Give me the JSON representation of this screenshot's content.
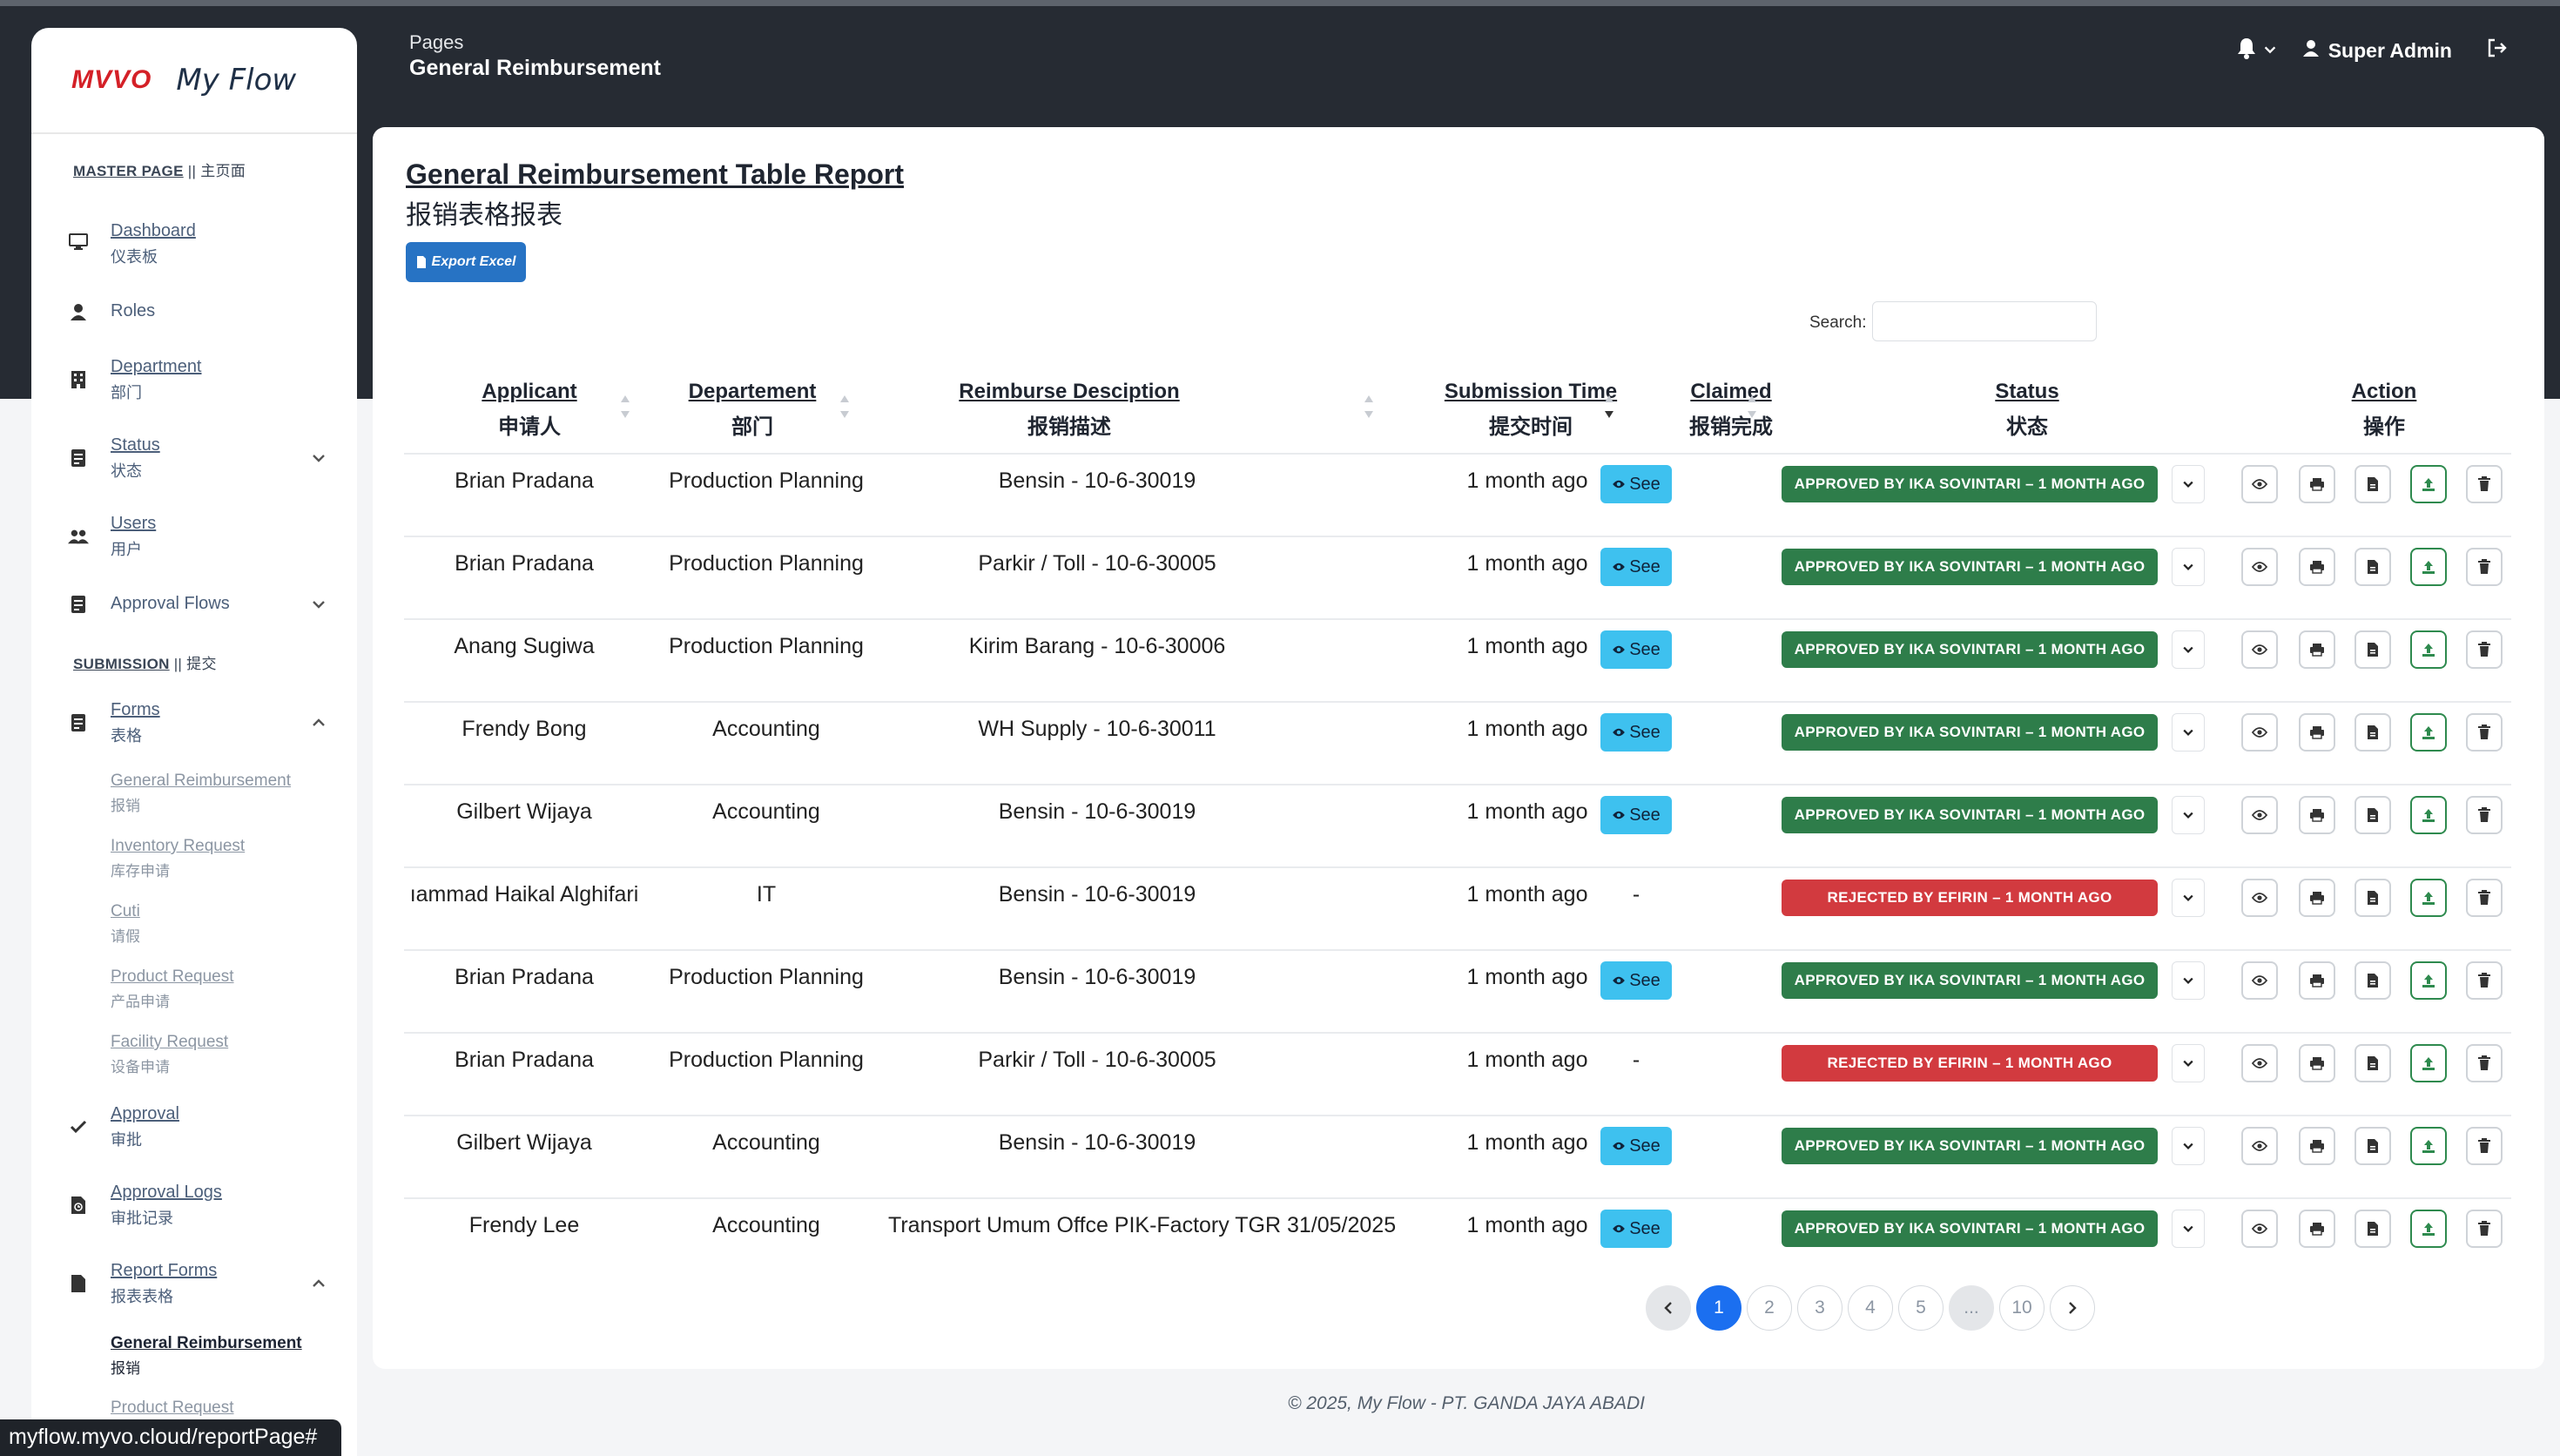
{
  "app": {
    "logo": "MVVO",
    "name": "My Flow"
  },
  "header": {
    "crumb": "Pages",
    "title": "General Reimbursement",
    "user": "Super Admin"
  },
  "sidebar": {
    "master_en": "MASTER PAGE",
    "master_cn": " || 主页面",
    "submission_en": "SUBMISSION",
    "submission_cn": " || 提交",
    "items": [
      {
        "label": "Dashboard",
        "cn": "仪表板"
      },
      {
        "label": "Roles",
        "cn": ""
      },
      {
        "label": "Department",
        "cn": "部门"
      },
      {
        "label": "Status",
        "cn": "状态"
      },
      {
        "label": "Users",
        "cn": "用户"
      },
      {
        "label": "Approval Flows",
        "cn": ""
      },
      {
        "label": "Forms",
        "cn": "表格"
      },
      {
        "label": "Approval",
        "cn": "审批"
      },
      {
        "label": "Approval Logs",
        "cn": "审批记录"
      },
      {
        "label": "Report Forms",
        "cn": "报表表格"
      }
    ],
    "forms_sub": [
      {
        "label": "General Reimbursement",
        "cn": "报销"
      },
      {
        "label": "Inventory Request",
        "cn": "库存申请"
      },
      {
        "label": "Cuti",
        "cn": "请假"
      },
      {
        "label": "Product Request",
        "cn": "产品申请"
      },
      {
        "label": "Facility Request",
        "cn": "设备申请"
      }
    ],
    "report_sub": [
      {
        "label": "General Reimbursement",
        "cn": "报销"
      },
      {
        "label": "Product Request",
        "cn": ""
      }
    ]
  },
  "report": {
    "title": "General Reimbursement Table Report",
    "title_cn": "报销表格报表",
    "export_label": "Export Excel",
    "search_label": "Search:",
    "search_value": ""
  },
  "columns": [
    {
      "en": "Applicant",
      "cn": "申请人"
    },
    {
      "en": "Departement",
      "cn": "部门"
    },
    {
      "en": "Reimburse Desciption",
      "cn": "报销描述"
    },
    {
      "en": "Submission Time",
      "cn": "提交时间"
    },
    {
      "en": "Claimed",
      "cn": "报销完成"
    },
    {
      "en": "Status",
      "cn": "状态"
    },
    {
      "en": "Action",
      "cn": "操作"
    }
  ],
  "rows": [
    {
      "applicant": "Brian Pradana",
      "dept": "Production Planning",
      "desc": "Bensin - 10-6-30019",
      "time": "1 month ago",
      "claimed": "See",
      "status": "APPROVED BY IKA SOVINTARI – 1 MONTH AGO",
      "kind": "approved"
    },
    {
      "applicant": "Brian Pradana",
      "dept": "Production Planning",
      "desc": "Parkir / Toll - 10-6-30005",
      "time": "1 month ago",
      "claimed": "See",
      "status": "APPROVED BY IKA SOVINTARI – 1 MONTH AGO",
      "kind": "approved"
    },
    {
      "applicant": "Anang Sugiwa",
      "dept": "Production Planning",
      "desc": "Kirim Barang - 10-6-30006",
      "time": "1 month ago",
      "claimed": "See",
      "status": "APPROVED BY IKA SOVINTARI – 1 MONTH AGO",
      "kind": "approved"
    },
    {
      "applicant": "Frendy Bong",
      "dept": "Accounting",
      "desc": "WH Supply - 10-6-30011",
      "time": "1 month ago",
      "claimed": "See",
      "status": "APPROVED BY IKA SOVINTARI – 1 MONTH AGO",
      "kind": "approved"
    },
    {
      "applicant": "Gilbert Wijaya",
      "dept": "Accounting",
      "desc": "Bensin - 10-6-30019",
      "time": "1 month ago",
      "claimed": "See",
      "status": "APPROVED BY IKA SOVINTARI – 1 MONTH AGO",
      "kind": "approved"
    },
    {
      "applicant": "ıammad Haikal Alghifari",
      "dept": "IT",
      "desc": "Bensin - 10-6-30019",
      "time": "1 month ago",
      "claimed": "-",
      "status": "REJECTED BY EFIRIN – 1 MONTH AGO",
      "kind": "rejected"
    },
    {
      "applicant": "Brian Pradana",
      "dept": "Production Planning",
      "desc": "Bensin - 10-6-30019",
      "time": "1 month ago",
      "claimed": "See",
      "status": "APPROVED BY IKA SOVINTARI – 1 MONTH AGO",
      "kind": "approved"
    },
    {
      "applicant": "Brian Pradana",
      "dept": "Production Planning",
      "desc": "Parkir / Toll - 10-6-30005",
      "time": "1 month ago",
      "claimed": "-",
      "status": "REJECTED BY EFIRIN – 1 MONTH AGO",
      "kind": "rejected"
    },
    {
      "applicant": "Gilbert Wijaya",
      "dept": "Accounting",
      "desc": "Bensin - 10-6-30019",
      "time": "1 month ago",
      "claimed": "See",
      "status": "APPROVED BY IKA SOVINTARI – 1 MONTH AGO",
      "kind": "approved"
    },
    {
      "applicant": "Frendy Lee",
      "dept": "Accounting",
      "desc": "Transport Umum Offce PIK-Factory TGR 31/05/2025",
      "time": "1 month ago",
      "claimed": "See",
      "status": "APPROVED BY IKA SOVINTARI – 1 MONTH AGO",
      "kind": "approved"
    }
  ],
  "pagination": {
    "pages": [
      "1",
      "2",
      "3",
      "4",
      "5",
      "...",
      "10"
    ],
    "current": "1"
  },
  "footer": "© 2025, My Flow - PT. GANDA JAYA ABADI",
  "statusbar_url": "myflow.myvo.cloud/reportPage#",
  "colors": {
    "approved": "#2e7d4a",
    "rejected": "#d23a3f",
    "see": "#3ec1ef",
    "accent": "#1b6ff0",
    "header_bg": "#262b33"
  }
}
